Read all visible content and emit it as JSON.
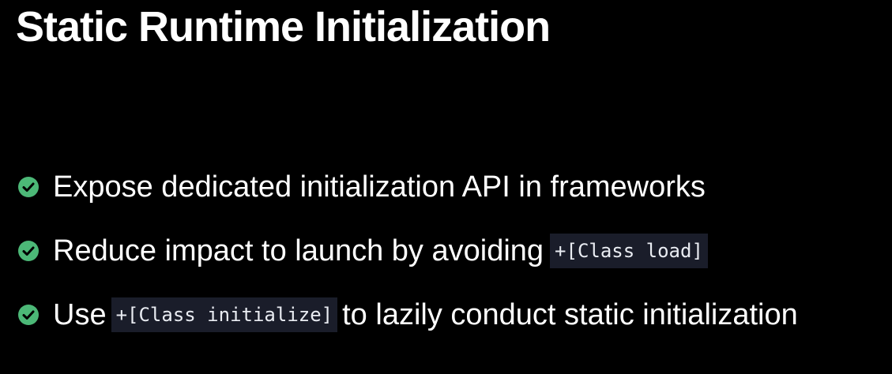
{
  "slide": {
    "title": "Static Runtime Initialization",
    "accent_color": "#4cb877",
    "bullets": [
      {
        "icon": "checkmark-circle-icon",
        "text": "Expose dedicated initialization API in frameworks"
      },
      {
        "icon": "checkmark-circle-icon",
        "text_before": "Reduce impact to launch by avoiding",
        "code": "+[Class load]"
      },
      {
        "icon": "checkmark-circle-icon",
        "text_before": "Use",
        "code": "+[Class initialize]",
        "text_after": "to lazily conduct static initialization"
      }
    ]
  }
}
